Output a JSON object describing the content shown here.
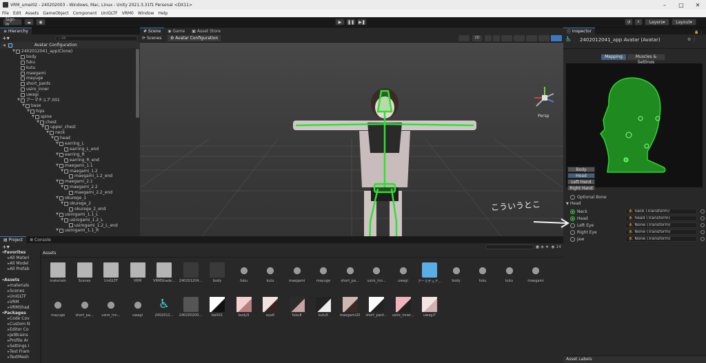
{
  "window": {
    "title": "VRM_umei02 - 240202003 - Windows, Mac, Linux - Unity 2021.3.31f1 Personal <DX11>"
  },
  "menu": [
    "File",
    "Edit",
    "Assets",
    "GameObject",
    "Component",
    "UniGLTF",
    "VRM0",
    "Window",
    "Help"
  ],
  "toolbar": {
    "signin": "Sign in",
    "layers": "Layers",
    "layout": "Layout"
  },
  "hierarchy": {
    "tab": "Hierarchy",
    "search_placeholder": "All",
    "scene_root": "Avatar Configuration",
    "items": [
      {
        "label": "2402012041_app(Clone)",
        "depth": 1,
        "arrow": true
      },
      {
        "label": "body",
        "depth": 2,
        "arrow": false
      },
      {
        "label": "fuku",
        "depth": 2,
        "arrow": false
      },
      {
        "label": "kutu",
        "depth": 2,
        "arrow": false
      },
      {
        "label": "maegami",
        "depth": 2,
        "arrow": false
      },
      {
        "label": "mayuge",
        "depth": 2,
        "arrow": false
      },
      {
        "label": "short_pants",
        "depth": 2,
        "arrow": false
      },
      {
        "label": "usiro_inner",
        "depth": 2,
        "arrow": false
      },
      {
        "label": "uwagi",
        "depth": 2,
        "arrow": false
      },
      {
        "label": "アーマチュア.001",
        "depth": 2,
        "arrow": true
      },
      {
        "label": "base",
        "depth": 3,
        "arrow": true
      },
      {
        "label": "hips",
        "depth": 4,
        "arrow": true
      },
      {
        "label": "spine",
        "depth": 5,
        "arrow": true
      },
      {
        "label": "chest",
        "depth": 6,
        "arrow": true
      },
      {
        "label": "upper_chest",
        "depth": 7,
        "arrow": true
      },
      {
        "label": "neck",
        "depth": 8,
        "arrow": true
      },
      {
        "label": "head",
        "depth": 9,
        "arrow": true
      },
      {
        "label": "earring_L",
        "depth": 10,
        "arrow": true
      },
      {
        "label": "earring_L_end",
        "depth": 11,
        "arrow": false
      },
      {
        "label": "earring_R",
        "depth": 10,
        "arrow": true
      },
      {
        "label": "earring_R_end",
        "depth": 11,
        "arrow": false
      },
      {
        "label": "maegami_1.1",
        "depth": 10,
        "arrow": true
      },
      {
        "label": "maegami_1.2",
        "depth": 11,
        "arrow": true
      },
      {
        "label": "maegami_1.2_end",
        "depth": 12,
        "arrow": false
      },
      {
        "label": "maegami_2.1",
        "depth": 10,
        "arrow": true
      },
      {
        "label": "maegami_2.2",
        "depth": 11,
        "arrow": true
      },
      {
        "label": "maegami_2.2_end",
        "depth": 12,
        "arrow": false
      },
      {
        "label": "okurege_1",
        "depth": 10,
        "arrow": true
      },
      {
        "label": "okurege_2",
        "depth": 11,
        "arrow": true
      },
      {
        "label": "okurege_2_end",
        "depth": 12,
        "arrow": false
      },
      {
        "label": "usirogami_1.1_L",
        "depth": 10,
        "arrow": true
      },
      {
        "label": "usirogami_1.2_L",
        "depth": 11,
        "arrow": true
      },
      {
        "label": "usirogami_1.2_L_end",
        "depth": 12,
        "arrow": false
      },
      {
        "label": "usirogami_1.1_R",
        "depth": 10,
        "arrow": true
      }
    ]
  },
  "scene": {
    "tabs": [
      "Scene",
      "Game",
      "Asset Store"
    ],
    "breadcrumb_scenes": "Scenes",
    "breadcrumb_current": "Avatar Configuration",
    "mode_2d": "2D",
    "persp": "Persp"
  },
  "inspector": {
    "tab": "Inspector",
    "object_title": "2402012041_app Avatar (Avatar)",
    "tab_mapping": "Mapping",
    "tab_muscles": "Muscles & Settings",
    "parts": [
      "Body",
      "Head",
      "Left Hand",
      "Right Hand"
    ],
    "optional_bone": "Optional Bone",
    "section": "Head",
    "bones": [
      {
        "name": "Neck",
        "value": "neck (Transform)",
        "on": true
      },
      {
        "name": "Head",
        "value": "head (Transform)",
        "on": true
      },
      {
        "name": "Left Eye",
        "value": "None (Transform)",
        "on": false
      },
      {
        "name": "Right Eye",
        "value": "None (Transform)",
        "on": false
      },
      {
        "name": "Jaw",
        "value": "None (Transform)",
        "on": false
      }
    ],
    "annotation": "こういうとこ",
    "asset_labels": "Asset Labels"
  },
  "project": {
    "tabs": [
      "Project",
      "Console"
    ],
    "breadcrumb": "Assets",
    "count": "14",
    "sidebar": [
      {
        "label": "Favorites",
        "depth": 0,
        "bold": true
      },
      {
        "label": "All Materi",
        "depth": 1,
        "bold": false
      },
      {
        "label": "All Model",
        "depth": 1,
        "bold": false
      },
      {
        "label": "All Prefab",
        "depth": 1,
        "bold": false
      },
      {
        "label": "",
        "depth": 0,
        "bold": false
      },
      {
        "label": "Assets",
        "depth": 0,
        "bold": true
      },
      {
        "label": "materials",
        "depth": 1,
        "bold": false
      },
      {
        "label": "Scenes",
        "depth": 1,
        "bold": false
      },
      {
        "label": "UniGLTF",
        "depth": 1,
        "bold": false
      },
      {
        "label": "VRM",
        "depth": 1,
        "bold": false
      },
      {
        "label": "VRMShad",
        "depth": 1,
        "bold": false
      },
      {
        "label": "Packages",
        "depth": 0,
        "bold": true
      },
      {
        "label": "Code Cov",
        "depth": 1,
        "bold": false
      },
      {
        "label": "Custom N",
        "depth": 1,
        "bold": false
      },
      {
        "label": "Editor Co",
        "depth": 1,
        "bold": false
      },
      {
        "label": "JetBrains",
        "depth": 1,
        "bold": false
      },
      {
        "label": "Profile Ar",
        "depth": 1,
        "bold": false
      },
      {
        "label": "Settings I",
        "depth": 1,
        "bold": false
      },
      {
        "label": "Test Fram",
        "depth": 1,
        "bold": false
      },
      {
        "label": "TextMesh",
        "depth": 1,
        "bold": false
      }
    ],
    "row1": [
      {
        "label": "materials",
        "kind": "folder"
      },
      {
        "label": "Scenes",
        "kind": "folder"
      },
      {
        "label": "UniGLTF",
        "kind": "folder"
      },
      {
        "label": "VRM",
        "kind": "folder"
      },
      {
        "label": "VRMShade...",
        "kind": "folder"
      },
      {
        "label": "240201204...",
        "kind": "model"
      },
      {
        "label": "body",
        "kind": "model"
      },
      {
        "label": "fuku",
        "kind": "mesh"
      },
      {
        "label": "kutu",
        "kind": "mesh"
      },
      {
        "label": "maegami",
        "kind": "mesh"
      },
      {
        "label": "mayuge",
        "kind": "mesh"
      },
      {
        "label": "short_pa...",
        "kind": "mesh"
      },
      {
        "label": "usiro_inn...",
        "kind": "mesh"
      },
      {
        "label": "uwagi",
        "kind": "mesh"
      },
      {
        "label": "アーマチュア...",
        "kind": "prefab"
      },
      {
        "label": "body",
        "kind": "mesh"
      },
      {
        "label": "fuku",
        "kind": "mesh"
      },
      {
        "label": "kutu",
        "kind": "mesh"
      },
      {
        "label": "maegami",
        "kind": "mesh"
      }
    ],
    "row2": [
      {
        "label": "mayuge",
        "kind": "mesh"
      },
      {
        "label": "short_pa...",
        "kind": "mesh"
      },
      {
        "label": "usiro_inn...",
        "kind": "mesh"
      },
      {
        "label": "uwagi",
        "kind": "mesh"
      },
      {
        "label": "2402012...",
        "kind": "avatar"
      },
      {
        "label": "240200200...",
        "kind": "unity"
      },
      {
        "label": "belt01",
        "kind": "tex1"
      },
      {
        "label": "body9",
        "kind": "tex2"
      },
      {
        "label": "eye6",
        "kind": "tex3"
      },
      {
        "label": "fuku8",
        "kind": "tex4"
      },
      {
        "label": "kutu5",
        "kind": "tex5"
      },
      {
        "label": "maegami20",
        "kind": "tex6"
      },
      {
        "label": "short_pant...",
        "kind": "tex7"
      },
      {
        "label": "usiro_inner...",
        "kind": "tex8"
      },
      {
        "label": "uwagi7",
        "kind": "tex9"
      }
    ]
  },
  "colors": {
    "accent": "#3a79bb",
    "bone_green": "#2fe02f",
    "head_silhouette": "#1f8a1f"
  }
}
